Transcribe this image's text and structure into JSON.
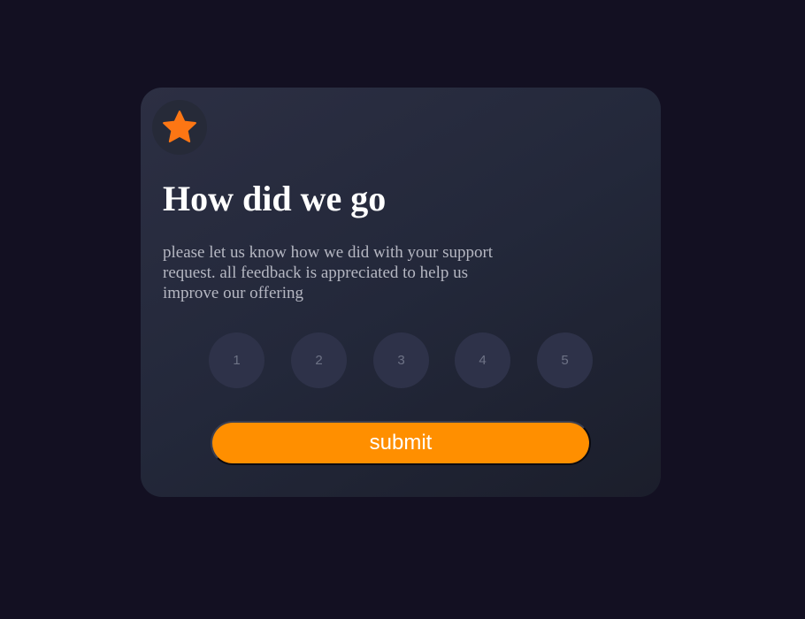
{
  "card": {
    "icon": "star-icon",
    "accent_color": "#ff8f00",
    "title": "How did we go",
    "description": "please let us know how we did with your support request. all feedback is appreciated to help us improve our offering",
    "ratings": [
      "1",
      "2",
      "3",
      "4",
      "5"
    ],
    "submit_label": "submit"
  }
}
